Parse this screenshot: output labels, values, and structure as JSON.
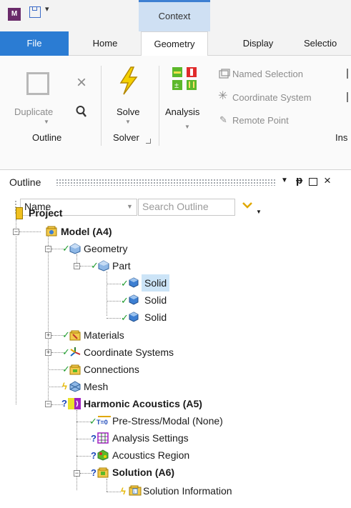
{
  "titlebar": {
    "app_icon": "M",
    "qat_dropdown": "▾",
    "context_label": "Context"
  },
  "tabs": {
    "file": "File",
    "home": "Home",
    "geometry": "Geometry",
    "display": "Display",
    "selection": "Selectio"
  },
  "ribbon": {
    "duplicate": "Duplicate",
    "outline_group": "Outline",
    "solve": "Solve",
    "solver_group": "Solver",
    "analysis": "Analysis",
    "named_selection": "Named Selection",
    "coordinate_system": "Coordinate System",
    "remote_point": "Remote Point",
    "insert_group": "Ins"
  },
  "outline": {
    "title": "Outline",
    "name_combo": "Name",
    "search_placeholder": "Search Outline"
  },
  "tree": {
    "project": "Project",
    "model": "Model (A4)",
    "geometry": "Geometry",
    "part": "Part",
    "solid1": "Solid",
    "solid2": "Solid",
    "solid3": "Solid",
    "materials": "Materials",
    "coordinate_systems": "Coordinate Systems",
    "connections": "Connections",
    "mesh": "Mesh",
    "harmonic": "Harmonic Acoustics (A5)",
    "prestress": "Pre-Stress/Modal (None)",
    "analysis_settings": "Analysis Settings",
    "acoustics_region": "Acoustics Region",
    "solution": "Solution (A6)",
    "solution_info": "Solution Information",
    "tzero": "T=0"
  },
  "colors": {
    "file_tab": "#2b7cd3",
    "context_tab": "#cfe0f3",
    "check": "#1f9b2d",
    "question": "#1a47b8",
    "bolt": "#e6b800"
  }
}
